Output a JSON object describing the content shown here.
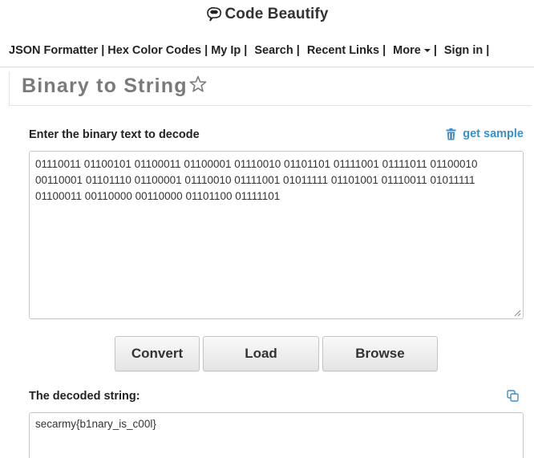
{
  "header": {
    "logo_text": "Code Beautify"
  },
  "nav": {
    "items": [
      {
        "label": "JSON Formatter |"
      },
      {
        "label": "Hex Color Codes |"
      },
      {
        "label": "My Ip |"
      },
      {
        "label": "Search |"
      },
      {
        "label": "Recent Links |"
      },
      {
        "label": "More"
      },
      {
        "label": "|"
      },
      {
        "label": "Sign in |"
      }
    ]
  },
  "page": {
    "title": "Binary to String"
  },
  "input": {
    "label": "Enter the binary text to decode",
    "get_sample": "get sample",
    "lines": [
      "01110011 01100101 01100011 01100001 01110010 01101101 01111001 01111011 01100010",
      "00110001 01101110 01100001 01110010 01111001 01011111 01101001 01110011 01011111",
      "01100011 00110000 00110000 01101100 01111101"
    ]
  },
  "buttons": {
    "convert": "Convert",
    "load": "Load",
    "browse": "Browse"
  },
  "output": {
    "label": "The decoded string:",
    "value": "secarmy{b1nary_is_c00l}"
  },
  "colors": {
    "accent": "#3a8fd0",
    "title_gray": "#7a7a7a"
  },
  "icons": {
    "logo": "brain-bubble-icon",
    "star": "star-outline-icon",
    "sample": "trash-icon",
    "copy": "copy-icon"
  }
}
